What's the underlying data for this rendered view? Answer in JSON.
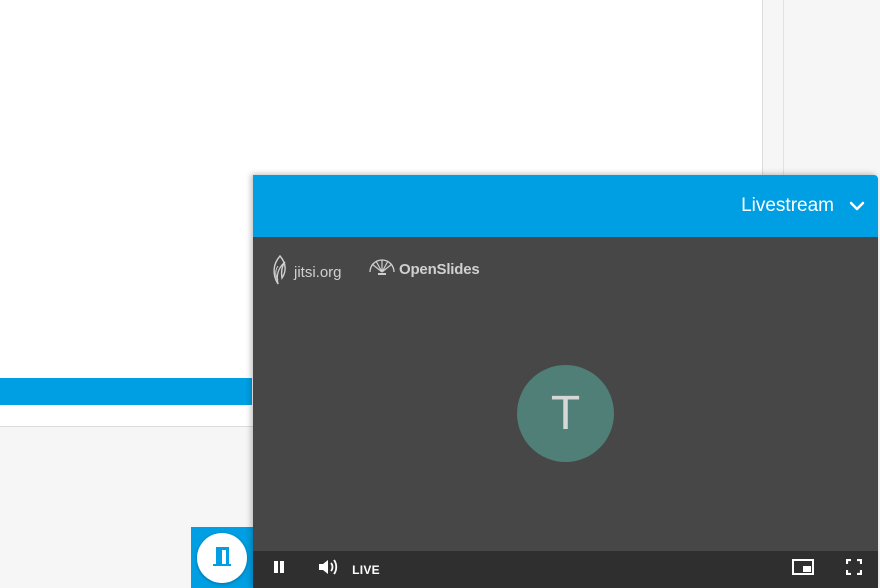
{
  "panel": {
    "title": "Livestream",
    "collapse_icon": "chevron-down-icon"
  },
  "video": {
    "logos": {
      "jitsi_text": "jitsi.org",
      "openslides_text": "OpenSlides"
    },
    "avatar_initial": "T",
    "avatar_color": "#4f7f76"
  },
  "controls": {
    "play_state_icon": "pause-icon",
    "volume_icon": "volume-icon",
    "live_label": "LIVE",
    "pip_icon": "picture-in-picture-icon",
    "fullscreen_icon": "fullscreen-icon"
  },
  "exit_button": {
    "icon": "exit-door-icon"
  },
  "colors": {
    "accent": "#009fe3",
    "video_bg": "#474747",
    "controls_bg": "#2f2f2f"
  }
}
